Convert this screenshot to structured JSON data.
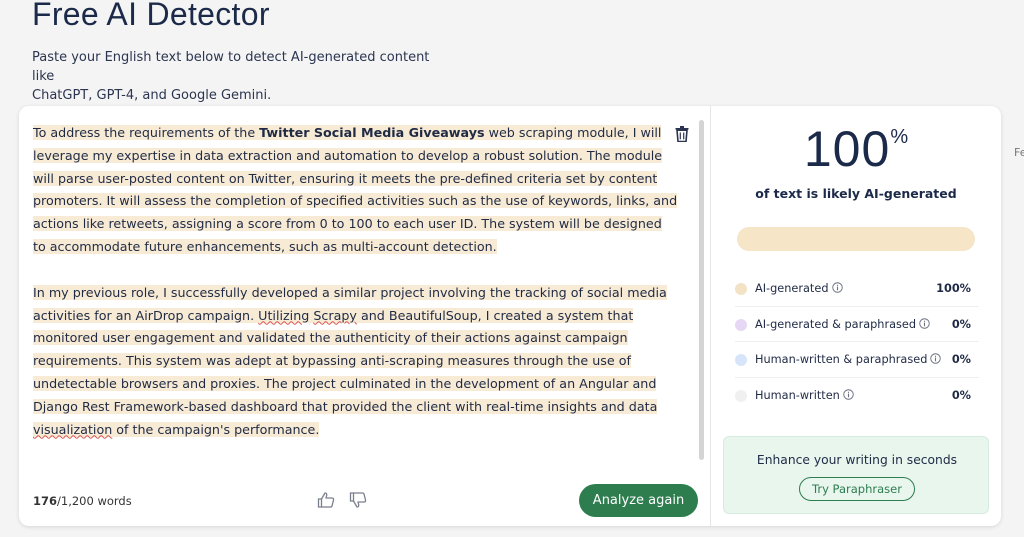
{
  "header": {
    "title": "Free AI Detector",
    "subtitle_line1": "Paste your English text below to detect AI-generated content like",
    "subtitle_line2": "ChatGPT, GPT-4, and Google Gemini."
  },
  "cut_label": "Fe",
  "editor": {
    "p1_a": "To address the requirements of the ",
    "p1_bold": "Twitter Social Media Giveaways",
    "p1_b": " web scraping module, I will leverage my expertise in data extraction and automation to develop a robust solution. The module will parse user-posted content on Twitter, ensuring it meets the pre-defined criteria set by content promoters. It will assess the completion of specified activities such as the use of keywords, links, and actions like retweets, assigning a score from 0 to 100 to each user ID. The system will be designed to accommodate future enhancements, such as multi-account detection.",
    "p2_a": "In my previous role, I successfully developed a similar project involving the tracking of social media activities for an AirDrop campaign. ",
    "p2_w1": "Utilizing",
    "p2_sp": " ",
    "p2_w2": "Scrapy",
    "p2_b": " and BeautifulSoup, I created a system that monitored user engagement and validated the authenticity of their actions against campaign requirements. This system was adept at bypassing anti-scraping measures through the use of undetectable browsers and proxies. The project culminated in the development of an Angular and Django Rest Framework-based dashboard that provided the client with real-time insights and data ",
    "p2_w3": "visualization",
    "p2_c": " of the campaign's performance."
  },
  "footer": {
    "word_count": "176",
    "word_limit": "/1,200 words",
    "analyze_label": "Analyze again"
  },
  "result": {
    "score": "100",
    "percent_sign": "%",
    "caption": "of text is likely AI-generated",
    "ai_fraction": 1.0,
    "legend": [
      {
        "label": "AI-generated",
        "value": "100%",
        "color": "#f3e2c5"
      },
      {
        "label": "AI-generated & paraphrased",
        "value": "0%",
        "color": "#e6d8f4"
      },
      {
        "label": "Human-written & paraphrased",
        "value": "0%",
        "color": "#d8e4fa"
      },
      {
        "label": "Human-written",
        "value": "0%",
        "color": "#f0f0f0"
      }
    ]
  },
  "promo": {
    "text": "Enhance your writing in seconds",
    "button_label": "Try Paraphraser"
  },
  "colors": {
    "accent": "#2e7d4f",
    "highlight": "#f8ebd6"
  }
}
